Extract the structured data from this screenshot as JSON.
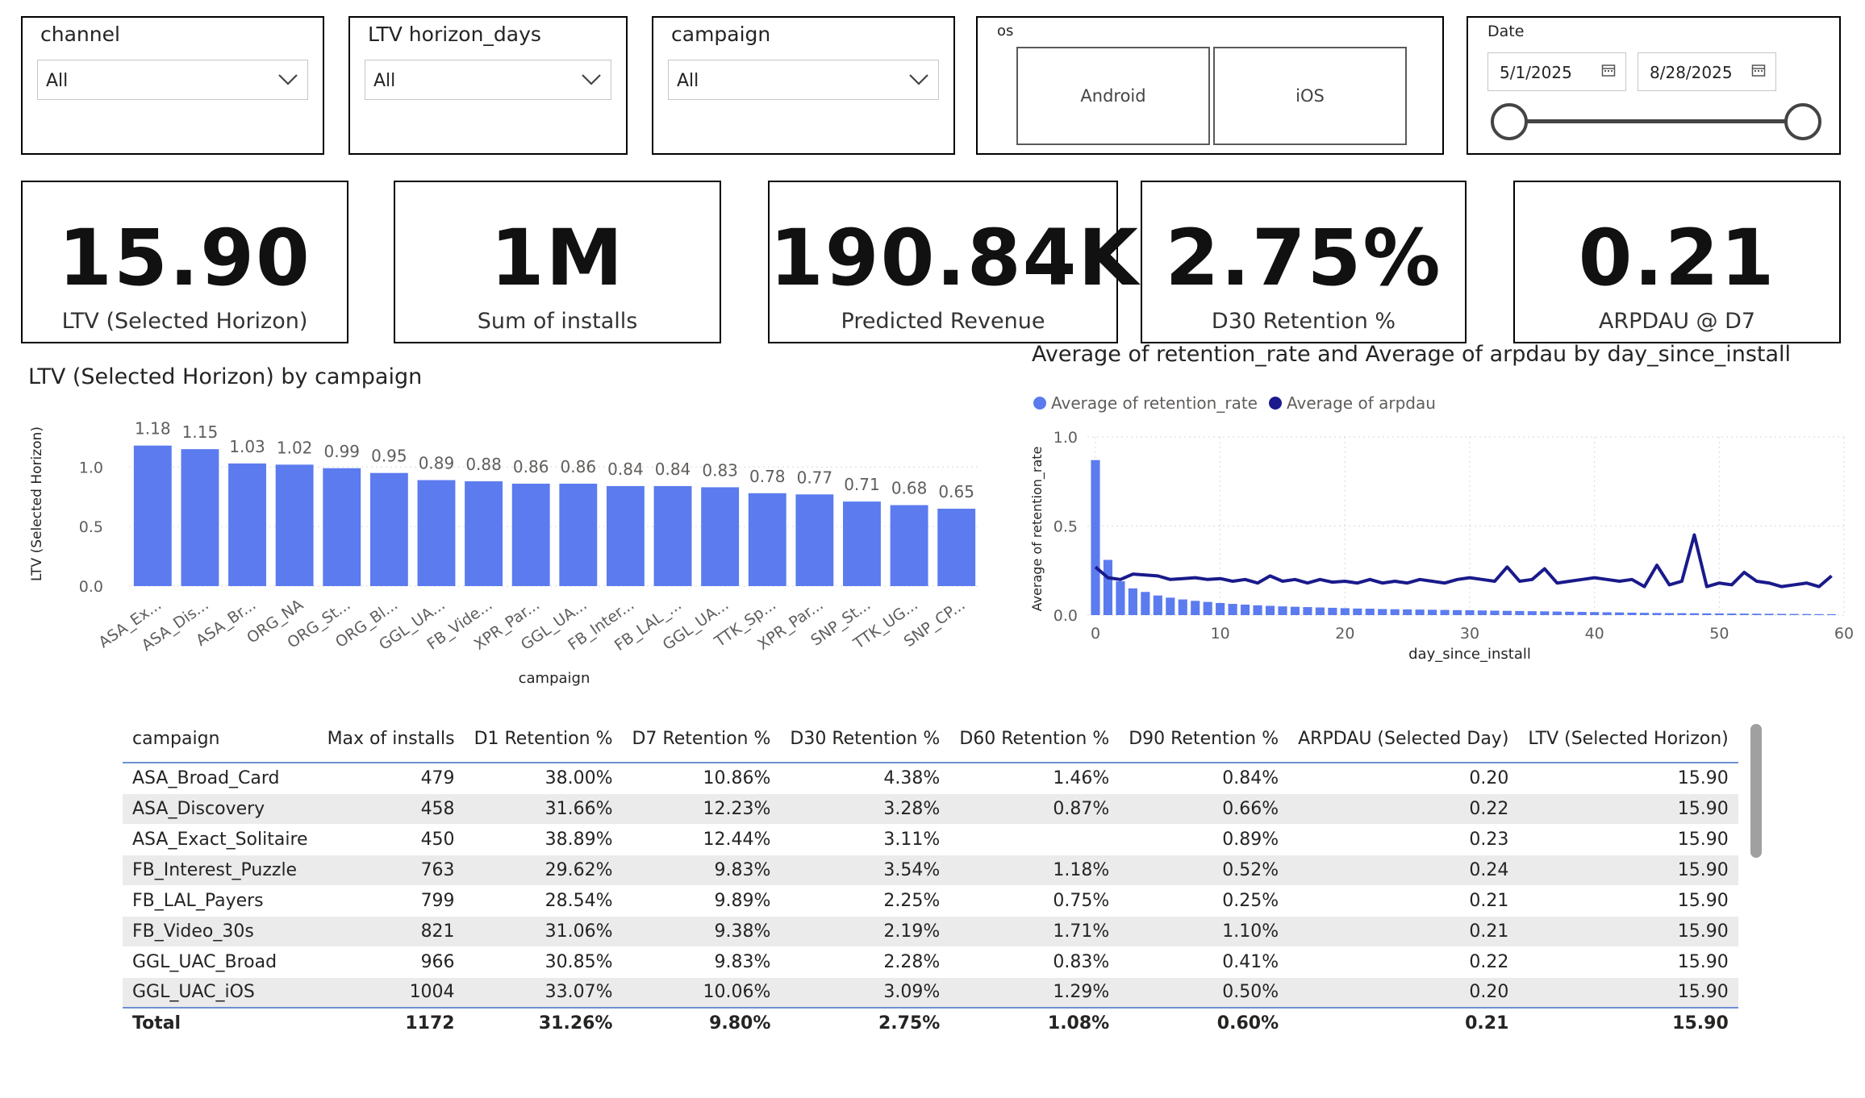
{
  "slicers": {
    "channel": {
      "title": "channel",
      "value": "All"
    },
    "ltv_horizon": {
      "title": "LTV horizon_days",
      "value": "All"
    },
    "campaign": {
      "title": "campaign",
      "value": "All"
    },
    "os": {
      "title": "os",
      "buttons": [
        "Android",
        "iOS"
      ]
    },
    "date": {
      "title": "Date",
      "start": "5/1/2025",
      "end": "8/28/2025"
    }
  },
  "kpis": [
    {
      "value": "15.90",
      "label": "LTV (Selected Horizon)"
    },
    {
      "value": "1M",
      "label": "Sum of installs"
    },
    {
      "value": "190.84K",
      "label": "Predicted Revenue"
    },
    {
      "value": "2.75%",
      "label": "D30 Retention %"
    },
    {
      "value": "0.21",
      "label": "ARPDAU @ D7"
    }
  ],
  "colors": {
    "bar": "#5B7BEF",
    "arpdau_line": "#1A1A8C",
    "retention": "#5B7BEF",
    "table_rule": "#6F8FD6"
  },
  "chart_data": [
    {
      "type": "bar",
      "title": "LTV (Selected Horizon) by campaign",
      "xlabel": "campaign",
      "ylabel": "LTV (Selected Horizon)",
      "categories": [
        "ASA_Ex...",
        "ASA_Dis...",
        "ASA_Br...",
        "ORG_NA",
        "ORG_St...",
        "ORG_Bl...",
        "GGL_UA...",
        "FB_Vide...",
        "XPR_Par...",
        "GGL_UA...",
        "FB_Inter...",
        "FB_LAL_...",
        "GGL_UA...",
        "TTK_Sp...",
        "XPR_Par...",
        "SNP_St...",
        "TTK_UG...",
        "SNP_CP..."
      ],
      "values": [
        1.18,
        1.15,
        1.03,
        1.02,
        0.99,
        0.95,
        0.89,
        0.88,
        0.86,
        0.86,
        0.84,
        0.84,
        0.83,
        0.78,
        0.77,
        0.71,
        0.68,
        0.65
      ],
      "value_labels": [
        "1.18",
        "1.15",
        "1.03",
        "1.02",
        "0.99",
        "0.95",
        "0.89",
        "0.88",
        "0.86",
        "0.86",
        "0.84",
        "0.84",
        "0.83",
        "0.78",
        "0.77",
        "0.71",
        "0.68",
        "0.65"
      ],
      "yticks": [
        "0.0",
        "0.5",
        "1.0"
      ],
      "ylim": [
        0,
        1.3
      ],
      "grid": true
    },
    {
      "type": "bar+line",
      "title": "Average of retention_rate and Average of arpdau by day_since_install",
      "xlabel": "day_since_install",
      "ylabel": "Average of retention_rate",
      "series": [
        {
          "name": "Average of retention_rate",
          "type": "bar",
          "x": [
            0,
            1,
            2,
            3,
            4,
            5,
            6,
            7,
            8,
            9,
            10,
            11,
            12,
            13,
            14,
            15,
            16,
            17,
            18,
            19,
            20,
            21,
            22,
            23,
            24,
            25,
            26,
            27,
            28,
            29,
            30,
            31,
            32,
            33,
            34,
            35,
            36,
            37,
            38,
            39,
            40,
            41,
            42,
            43,
            44,
            45,
            46,
            47,
            48,
            49,
            50,
            51,
            52,
            53,
            54,
            55,
            56,
            57,
            58,
            59
          ],
          "values": [
            0.87,
            0.31,
            0.19,
            0.15,
            0.13,
            0.11,
            0.098,
            0.088,
            0.08,
            0.074,
            0.068,
            0.063,
            0.059,
            0.055,
            0.052,
            0.049,
            0.047,
            0.045,
            0.043,
            0.041,
            0.039,
            0.037,
            0.036,
            0.034,
            0.033,
            0.032,
            0.031,
            0.03,
            0.029,
            0.028,
            0.0275,
            0.026,
            0.025,
            0.024,
            0.023,
            0.022,
            0.021,
            0.02,
            0.019,
            0.018,
            0.017,
            0.016,
            0.015,
            0.014,
            0.013,
            0.012,
            0.0115,
            0.011,
            0.0105,
            0.01,
            0.0095,
            0.009,
            0.0085,
            0.008,
            0.0075,
            0.007,
            0.0065,
            0.006,
            0.0055,
            0.005
          ]
        },
        {
          "name": "Average of arpdau",
          "type": "line",
          "x": [
            0,
            1,
            2,
            3,
            4,
            5,
            6,
            7,
            8,
            9,
            10,
            11,
            12,
            13,
            14,
            15,
            16,
            17,
            18,
            19,
            20,
            21,
            22,
            23,
            24,
            25,
            26,
            27,
            28,
            29,
            30,
            31,
            32,
            33,
            34,
            35,
            36,
            37,
            38,
            39,
            40,
            41,
            42,
            43,
            44,
            45,
            46,
            47,
            48,
            49,
            50,
            51,
            52,
            53,
            54,
            55,
            56,
            57,
            58,
            59
          ],
          "values": [
            0.27,
            0.21,
            0.2,
            0.23,
            0.225,
            0.22,
            0.2,
            0.205,
            0.21,
            0.2,
            0.205,
            0.19,
            0.2,
            0.18,
            0.22,
            0.19,
            0.2,
            0.18,
            0.2,
            0.185,
            0.19,
            0.18,
            0.2,
            0.18,
            0.19,
            0.18,
            0.2,
            0.19,
            0.18,
            0.2,
            0.21,
            0.2,
            0.19,
            0.27,
            0.19,
            0.2,
            0.26,
            0.18,
            0.19,
            0.2,
            0.21,
            0.2,
            0.19,
            0.2,
            0.16,
            0.28,
            0.17,
            0.19,
            0.45,
            0.16,
            0.18,
            0.17,
            0.24,
            0.19,
            0.18,
            0.16,
            0.17,
            0.18,
            0.16,
            0.22
          ]
        }
      ],
      "xticks": [
        "0",
        "10",
        "20",
        "30",
        "40",
        "50",
        "60"
      ],
      "yticks": [
        "0.0",
        "0.5",
        "1.0"
      ],
      "xlim": [
        0,
        60
      ],
      "ylim": [
        0,
        1.0
      ],
      "legend": "top-left",
      "grid": true
    }
  ],
  "table": {
    "headers": [
      "campaign",
      "Max of installs",
      "D1 Retention %",
      "D7 Retention %",
      "D30 Retention %",
      "D60 Retention %",
      "D90 Retention %",
      "ARPDAU (Selected Day)",
      "LTV (Selected Horizon)"
    ],
    "rows": [
      [
        "ASA_Broad_Card",
        "479",
        "38.00%",
        "10.86%",
        "4.38%",
        "1.46%",
        "0.84%",
        "0.20",
        "15.90"
      ],
      [
        "ASA_Discovery",
        "458",
        "31.66%",
        "12.23%",
        "3.28%",
        "0.87%",
        "0.66%",
        "0.22",
        "15.90"
      ],
      [
        "ASA_Exact_Solitaire",
        "450",
        "38.89%",
        "12.44%",
        "3.11%",
        "",
        "0.89%",
        "0.23",
        "15.90"
      ],
      [
        "FB_Interest_Puzzle",
        "763",
        "29.62%",
        "9.83%",
        "3.54%",
        "1.18%",
        "0.52%",
        "0.24",
        "15.90"
      ],
      [
        "FB_LAL_Payers",
        "799",
        "28.54%",
        "9.89%",
        "2.25%",
        "0.75%",
        "0.25%",
        "0.21",
        "15.90"
      ],
      [
        "FB_Video_30s",
        "821",
        "31.06%",
        "9.38%",
        "2.19%",
        "1.71%",
        "1.10%",
        "0.21",
        "15.90"
      ],
      [
        "GGL_UAC_Broad",
        "966",
        "30.85%",
        "9.83%",
        "2.28%",
        "0.83%",
        "0.41%",
        "0.22",
        "15.90"
      ],
      [
        "GGL_UAC_iOS",
        "1004",
        "33.07%",
        "10.06%",
        "3.09%",
        "1.29%",
        "0.50%",
        "0.20",
        "15.90"
      ]
    ],
    "total": [
      "Total",
      "1172",
      "31.26%",
      "9.80%",
      "2.75%",
      "1.08%",
      "0.60%",
      "0.21",
      "15.90"
    ]
  }
}
